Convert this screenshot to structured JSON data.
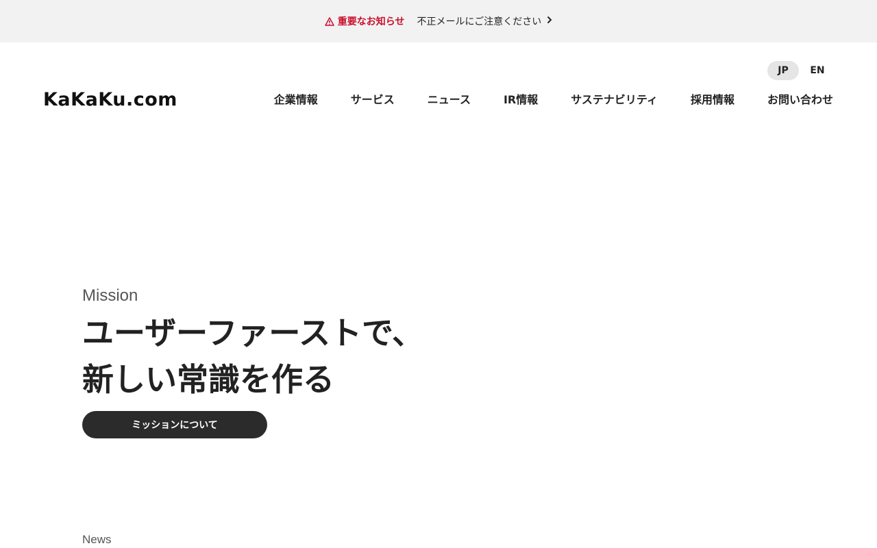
{
  "notice": {
    "label": "重要なお知らせ",
    "message": "不正メールにご注意ください",
    "icon": "warning-icon",
    "accent_color": "#c8102e"
  },
  "header": {
    "logo_text": "KaKaKu.com",
    "languages": [
      {
        "label": "JP",
        "active": true
      },
      {
        "label": "EN",
        "active": false
      }
    ],
    "nav": [
      {
        "label": "企業情報"
      },
      {
        "label": "サービス"
      },
      {
        "label": "ニュース"
      },
      {
        "label": "IR情報"
      },
      {
        "label": "サステナビリティ"
      },
      {
        "label": "採用情報"
      },
      {
        "label": "お問い合わせ"
      }
    ]
  },
  "hero": {
    "eyebrow": "Mission",
    "title_line1": "ユーザーファーストで、",
    "title_line2": "新しい常識を作る",
    "button_label": "ミッションについて",
    "button_color": "#2b2b2b"
  },
  "news": {
    "label": "News"
  }
}
